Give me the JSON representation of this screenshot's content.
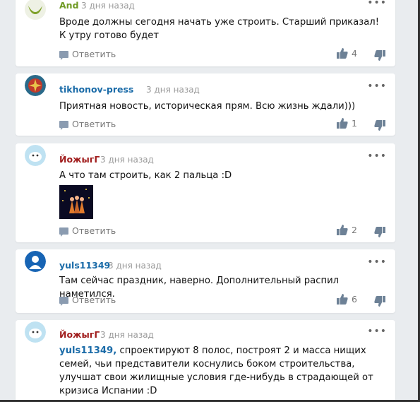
{
  "reply_label": "Ответить",
  "comments": [
    {
      "author": "And",
      "time": "3 дня назад",
      "text": "Вроде должны сегодня начать уже строить. Старший приказал! К утру готово будет",
      "likes": "4"
    },
    {
      "author": "tikhonov-press",
      "time": "3 дня назад",
      "text": "Приятная новость, историческая прям. Всю жизнь ждали)))",
      "likes": "1"
    },
    {
      "author": "ЙожыгГ",
      "time": "3 дня назад",
      "text": "А что там строить, как 2 пальца :D",
      "likes": "2"
    },
    {
      "author": "yuls11349",
      "time": "3 дня назад",
      "text": "Там сейчас праздник, наверно. Дополнительный распил наметился.",
      "likes": "6"
    },
    {
      "author": "ЙожыгГ",
      "time": "3 дня назад",
      "mention": "yuls11349,",
      "text": " спроектируют 8 полос, построят 2 и масса нищих семей, чьи представители коснулись боком строительства, улучшат свои жилищные условия где-нибудь в страдающей от кризиса Испании :D"
    }
  ],
  "colors": {
    "accent_blue": "#1a6ba8",
    "author_red": "#a01c1c",
    "author_green": "#6f9a24",
    "background": "#e9ecef"
  },
  "icons": [
    "comment-icon",
    "thumbs-up-icon",
    "thumbs-down-icon",
    "more-icon",
    "avatar-icon"
  ]
}
